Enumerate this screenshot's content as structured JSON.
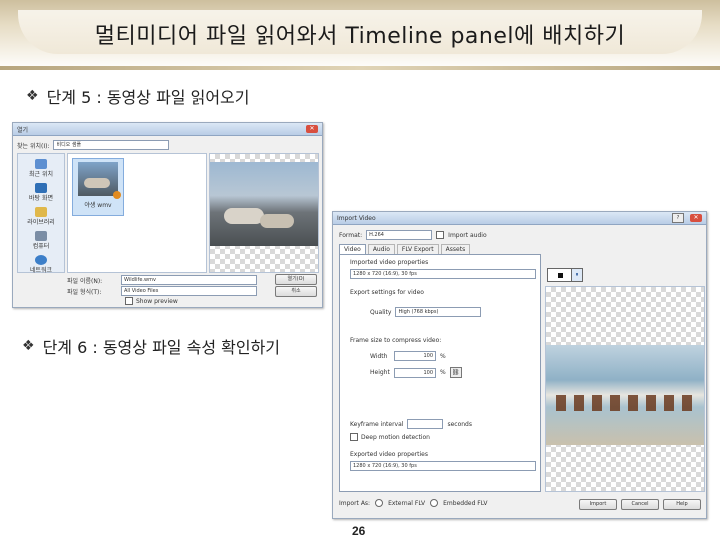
{
  "slide": {
    "title": "멀티미디어 파일 읽어와서 Timeline panel에 배치하기",
    "page_number": "26"
  },
  "bullets": {
    "step5": "단계 5 : 동영상 파일 읽어오기",
    "step6": "단계 6 : 동영상 파일 속성 확인하기"
  },
  "open_dialog": {
    "title": "열기",
    "look_in_label": "찾는 위치(I):",
    "look_in_value": "비디오 샘플",
    "sidebar": [
      {
        "label": "최근 위치",
        "icon": "recent-places-icon"
      },
      {
        "label": "바탕 화면",
        "icon": "desktop-icon"
      },
      {
        "label": "라이브러리",
        "icon": "libraries-icon"
      },
      {
        "label": "컴퓨터",
        "icon": "computer-icon"
      },
      {
        "label": "네트워크",
        "icon": "network-icon"
      }
    ],
    "file_name": "야생 wmv",
    "file_name_label": "파일 이름(N):",
    "file_name_value": "Wildlife.wmv",
    "file_type_label": "파일 형식(T):",
    "file_type_value": "All Video Files",
    "show_preview": "Show preview",
    "open_button": "열기(O)",
    "cancel_button": "취소"
  },
  "import_dialog": {
    "title": "Import Video",
    "format_label": "Format:",
    "format_value": "H.264",
    "import_audio": "Import audio",
    "tabs": [
      "Video",
      "Audio",
      "FLV Export",
      "Assets"
    ],
    "source_section": "Imported video properties",
    "source_info": "1280 x 720 (16:9), 30 fps",
    "export_section": "Export settings for video",
    "quality_label": "Quality",
    "quality_value": "High (768 kbps)",
    "frame_size_section": "Frame size to compress video:",
    "width_label": "Width",
    "width_value": "100",
    "height_label": "Height",
    "height_value": "100",
    "percent": "%",
    "keyframe_label": "Keyframe interval",
    "keyframe_unit": "seconds",
    "deep_motion": "Deep motion detection",
    "exported_section": "Exported video properties",
    "exported_info": "1280 x 720 (16:9), 30 fps",
    "import_as_label": "Import As:",
    "import_as_external": "External FLV",
    "import_as_embedded": "Embedded FLV",
    "import_button": "Import",
    "cancel_button": "Cancel",
    "help_button": "Help"
  }
}
